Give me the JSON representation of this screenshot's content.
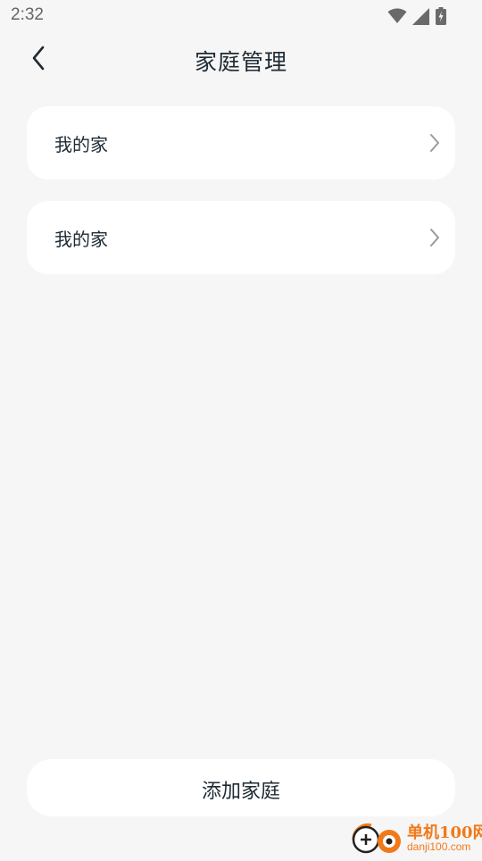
{
  "status_bar": {
    "time": "2:32",
    "icons": [
      "wifi-icon",
      "signal-icon",
      "battery-charging-icon"
    ]
  },
  "header": {
    "back_icon": "chevron-left-icon",
    "title": "家庭管理"
  },
  "homes": [
    {
      "name": "我的家"
    },
    {
      "name": "我的家"
    }
  ],
  "footer": {
    "add_button_label": "添加家庭"
  },
  "watermark": {
    "name": "单机100网",
    "url": "danji100.com"
  },
  "colors": {
    "background": "#f6f6f6",
    "card": "#ffffff",
    "text": "#1e2a33",
    "chevron": "#9a9a9a",
    "watermark": "#f07a1a"
  }
}
